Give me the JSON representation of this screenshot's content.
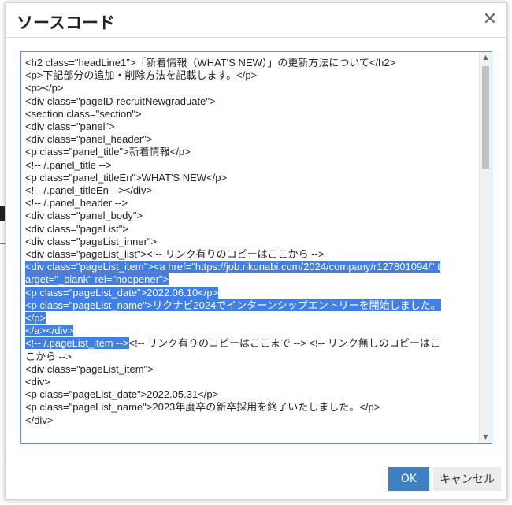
{
  "dialog": {
    "title": "ソースコード",
    "close_icon": "close-icon",
    "ok_label": "OK",
    "cancel_label": "キャンセル"
  },
  "source_lines": [
    {
      "text": "<h2 class=\"headLine1\">「新着情報（WHAT'S NEW）」の更新方法について</h2>",
      "selected": false
    },
    {
      "text": "<p>下記部分の追加・削除方法を記載します。</p>",
      "selected": false
    },
    {
      "text": "<p></p>",
      "selected": false
    },
    {
      "text": "<div class=\"pageID-recruitNewgraduate\">",
      "selected": false
    },
    {
      "text": "<section class=\"section\">",
      "selected": false
    },
    {
      "text": "<div class=\"panel\">",
      "selected": false
    },
    {
      "text": "<div class=\"panel_header\">",
      "selected": false
    },
    {
      "text": "<p class=\"panel_title\">新着情報</p>",
      "selected": false
    },
    {
      "text": "<!-- /.panel_title -->",
      "selected": false
    },
    {
      "text": "<p class=\"panel_titleEn\">WHAT'S NEW</p>",
      "selected": false
    },
    {
      "text": "<!-- /.panel_titleEn --></div>",
      "selected": false
    },
    {
      "text": "<!-- /.panel_header -->",
      "selected": false
    },
    {
      "text": "<div class=\"panel_body\">",
      "selected": false
    },
    {
      "text": "<div class=\"pageList\">",
      "selected": false
    },
    {
      "text": "<div class=\"pageList_inner\">",
      "selected": false
    },
    {
      "text": "<div class=\"pageList_list\"><!-- リンク有りのコピーはここから -->",
      "selected": false
    },
    {
      "text": "<div class=\"pageList_item\"><a href=\"https://job.rikunabi.com/2024/company/r127801094/\" t",
      "selected": true
    },
    {
      "text": "arget=\"_blank\" rel=\"noopener\">",
      "selected": true
    },
    {
      "text": "<p class=\"pageList_date\">2022.06.10</p>",
      "selected": true
    },
    {
      "text": "<p class=\"pageList_name\">リクナビ2024でインターンシップエントリーを開始しました。",
      "selected": true
    },
    {
      "text": "</p>",
      "selected": true
    },
    {
      "text": "</a></div>",
      "selected": true
    },
    {
      "text": "<!-- /.pageList_item -->",
      "selected": true,
      "suffix": "<!-- リンク有りのコピーはここまで --> <!-- リンク無しのコピーはこ"
    },
    {
      "text": "こから -->",
      "selected": false
    },
    {
      "text": "<div class=\"pageList_item\">",
      "selected": false
    },
    {
      "text": "<div>",
      "selected": false
    },
    {
      "text": "<p class=\"pageList_date\">2022.05.31</p>",
      "selected": false
    },
    {
      "text": "<p class=\"pageList_name\">2023年度卒の新卒採用を終了いたしました。</p>",
      "selected": false
    },
    {
      "text": "</div>",
      "selected": false
    }
  ]
}
